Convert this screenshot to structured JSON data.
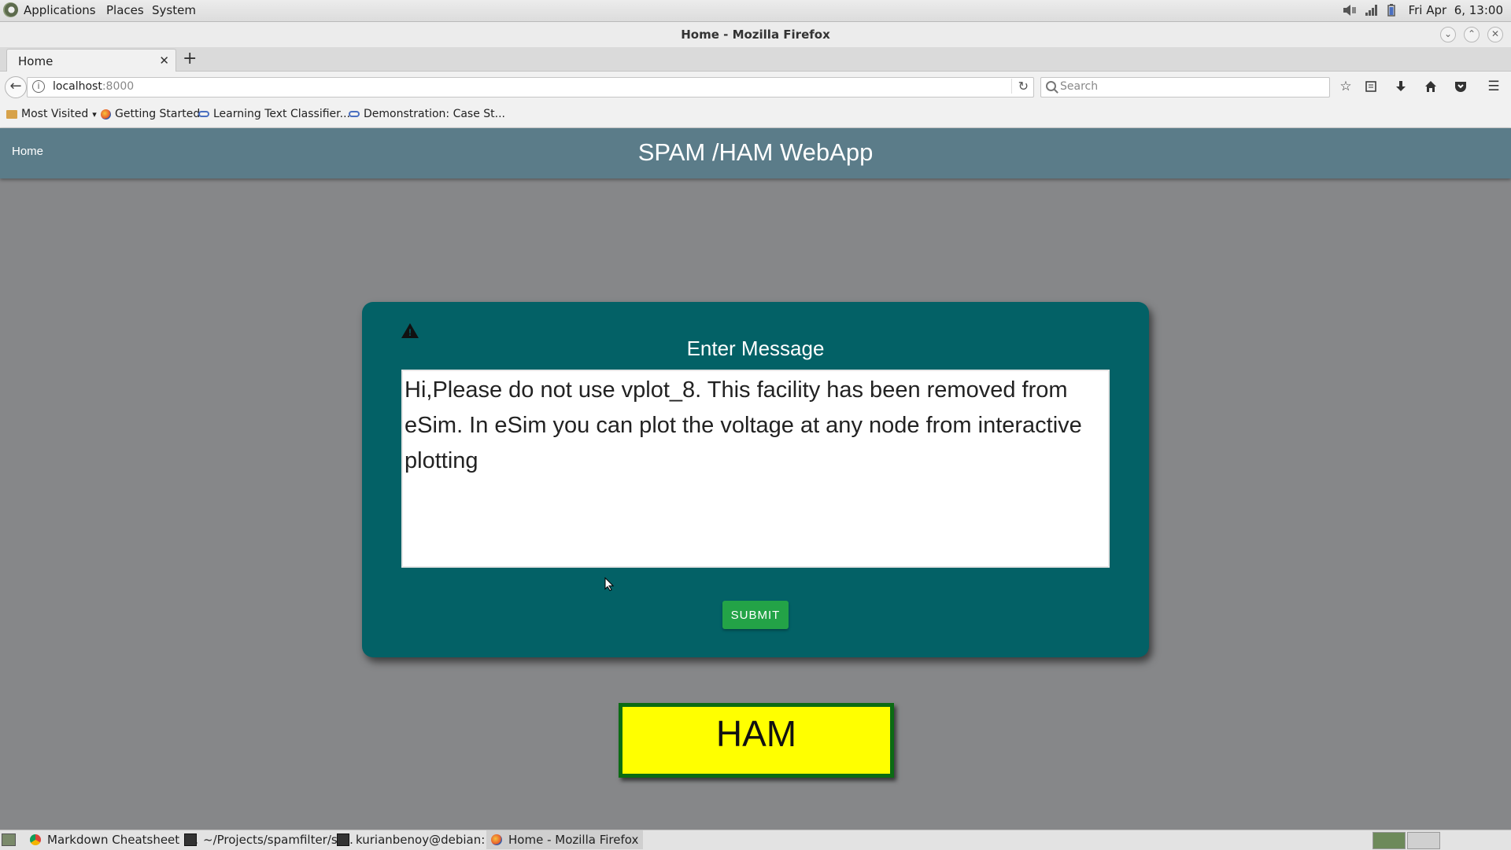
{
  "panel": {
    "menus": [
      "Applications",
      "Places",
      "System"
    ],
    "clock": "Fri Apr  6, 13:00"
  },
  "window": {
    "title": "Home - Mozilla Firefox"
  },
  "browser": {
    "tab_title": "Home",
    "url_host": "localhost",
    "url_port": ":8000",
    "search_placeholder": "Search",
    "bookmarks": [
      "Most Visited",
      "Getting Started",
      "Learning Text Classifier...",
      "Demonstration: Case St..."
    ]
  },
  "app": {
    "nav_home": "Home",
    "title": "SPAM /HAM WebApp",
    "form_title": "Enter Message",
    "message": "Hi,Please do not use vplot_8. This facility has been removed from eSim. In eSim you can plot the voltage at any node from interactive plotting",
    "submit_label": "SUBMIT",
    "result": "HAM",
    "colors": {
      "navbar": "#5b7c89",
      "card": "#036166",
      "submit": "#23a347",
      "result_bg": "#ffff00",
      "result_border": "#0b6b13"
    }
  },
  "taskbar": {
    "items": [
      "Markdown Cheatsheet ·...",
      "~/Projects/spamfilter/st...",
      "kurianbenoy@debian: ~...",
      "Home - Mozilla Firefox"
    ]
  }
}
